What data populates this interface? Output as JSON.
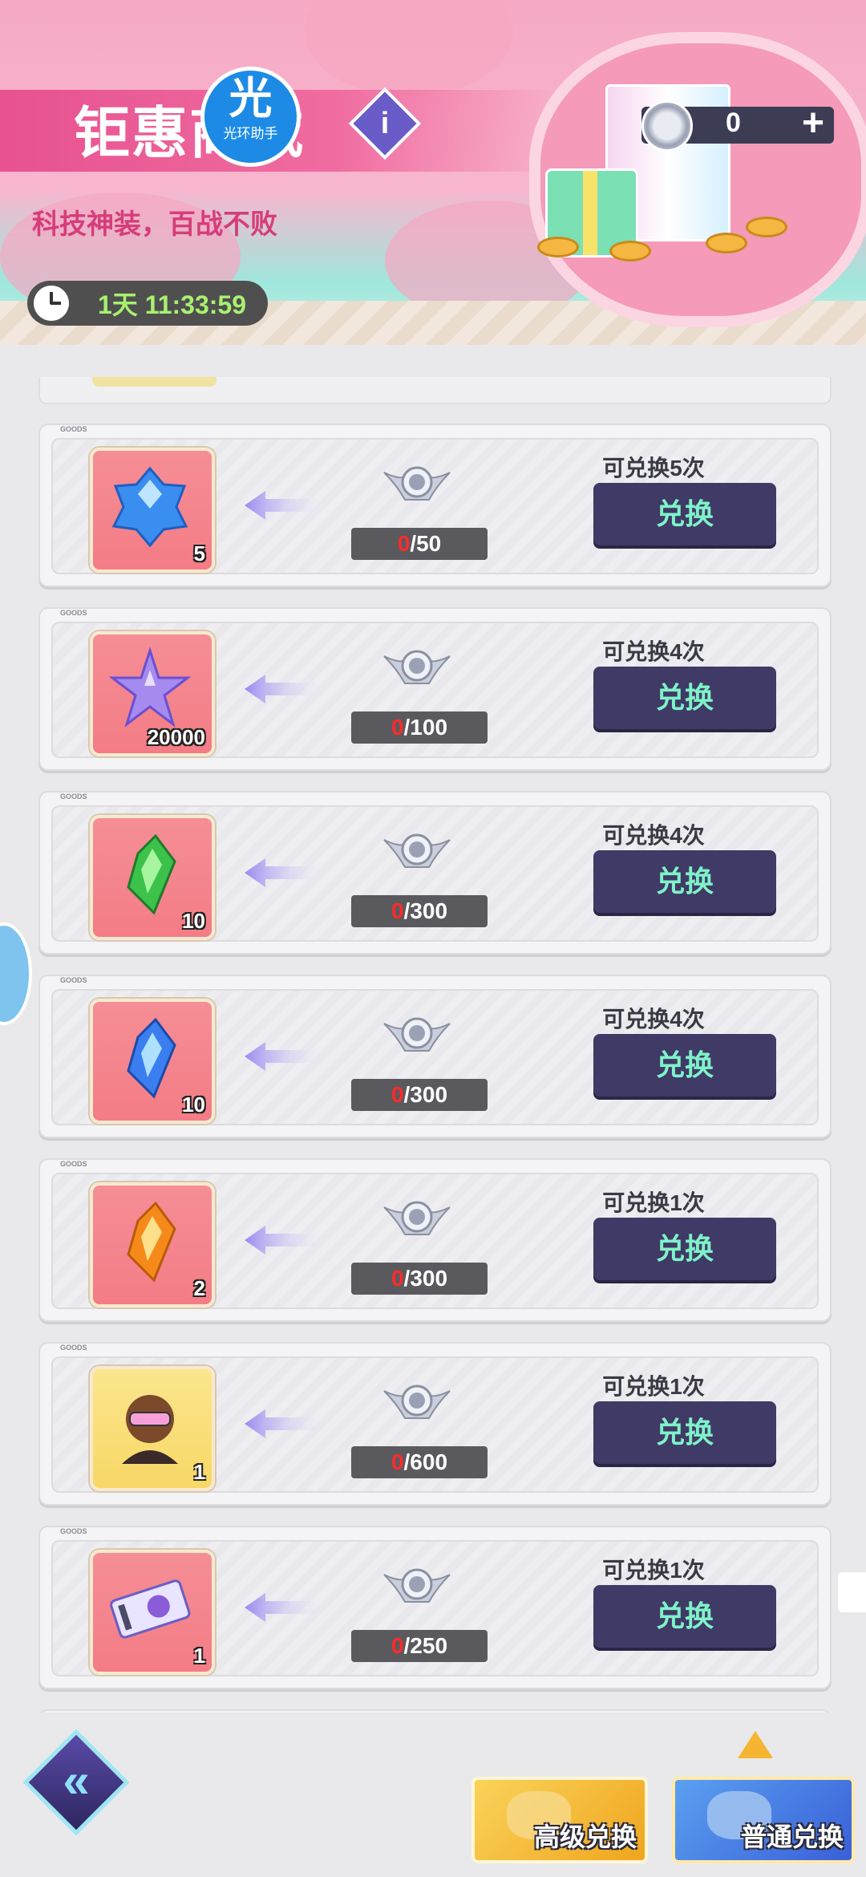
{
  "header": {
    "title": "钜惠商城",
    "logo_main": "光",
    "logo_sub": "光环助手",
    "info_icon": "i",
    "subtitle": "科技神装，百战不败",
    "timer": "1天 11:33:59",
    "currency": {
      "icon": "silver-medal-icon",
      "value": "0",
      "plus": "+"
    }
  },
  "items": [
    {
      "icon": "blue-crystal-icon",
      "quantity": "5",
      "owned": "0",
      "cost": "/50",
      "limit": "可兑换5次",
      "button": "兑换"
    },
    {
      "icon": "purple-star-icon",
      "quantity": "20000",
      "owned": "0",
      "cost": "/100",
      "limit": "可兑换4次",
      "button": "兑换"
    },
    {
      "icon": "green-shard-icon",
      "quantity": "10",
      "owned": "0",
      "cost": "/300",
      "limit": "可兑换4次",
      "button": "兑换"
    },
    {
      "icon": "blue-shard-icon",
      "quantity": "10",
      "owned": "0",
      "cost": "/300",
      "limit": "可兑换4次",
      "button": "兑换"
    },
    {
      "icon": "orange-shard-icon",
      "quantity": "2",
      "owned": "0",
      "cost": "/300",
      "limit": "可兑换1次",
      "button": "兑换"
    },
    {
      "icon": "character-avatar-icon",
      "quantity": "1",
      "owned": "0",
      "cost": "/600",
      "limit": "可兑换1次",
      "button": "兑换"
    },
    {
      "icon": "ticket-icon",
      "quantity": "1",
      "owned": "0",
      "cost": "/250",
      "limit": "可兑换1次",
      "button": "兑换"
    }
  ],
  "card_tag": "GOODS",
  "footer": {
    "back_label": "«",
    "tab_advanced": "高级兑换",
    "tab_normal": "普通兑换"
  },
  "colors": {
    "button_bg": "#3f3a66",
    "button_text": "#7ff2c8",
    "item_bg": "#f47c86",
    "header_pink": "#f06ca0"
  }
}
